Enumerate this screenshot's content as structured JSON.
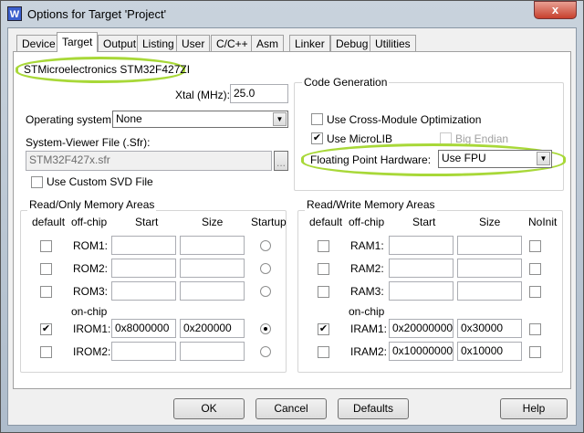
{
  "window": {
    "title": "Options for Target 'Project'",
    "icon": "W",
    "close": "x"
  },
  "tabs": [
    "Device",
    "Target",
    "Output",
    "Listing",
    "User",
    "C/C++",
    "Asm",
    "Linker",
    "Debug",
    "Utilities"
  ],
  "active_tab": "Target",
  "device": "STMicroelectronics STM32F427ZI",
  "xtal": {
    "label": "Xtal (MHz):",
    "value": "25.0"
  },
  "os": {
    "label": "Operating system:",
    "value": "None"
  },
  "svf": {
    "label": "System-Viewer File (.Sfr):",
    "value": "STM32F427x.sfr",
    "browse": "..."
  },
  "custom_svd": {
    "label": "Use Custom SVD File",
    "checked": false
  },
  "codegen": {
    "title": "Code Generation",
    "cross_module": "Use Cross-Module Optimization",
    "microlib": "Use MicroLIB",
    "big_endian": "Big Endian",
    "fph_label": "Floating Point Hardware:",
    "fph_value": "Use FPU"
  },
  "ro": {
    "title": "Read/Only Memory Areas",
    "headers": [
      "default",
      "off-chip",
      "Start",
      "Size",
      "Startup"
    ],
    "onchip": "on-chip",
    "rows": [
      {
        "name": "ROM1:",
        "default": false,
        "start": "",
        "size": "",
        "sel": false
      },
      {
        "name": "ROM2:",
        "default": false,
        "start": "",
        "size": "",
        "sel": false
      },
      {
        "name": "ROM3:",
        "default": false,
        "start": "",
        "size": "",
        "sel": false
      },
      {
        "name": "IROM1:",
        "default": true,
        "start": "0x8000000",
        "size": "0x200000",
        "sel": true
      },
      {
        "name": "IROM2:",
        "default": false,
        "start": "",
        "size": "",
        "sel": false
      }
    ]
  },
  "rw": {
    "title": "Read/Write Memory Areas",
    "headers": [
      "default",
      "off-chip",
      "Start",
      "Size",
      "NoInit"
    ],
    "onchip": "on-chip",
    "rows": [
      {
        "name": "RAM1:",
        "default": false,
        "start": "",
        "size": "",
        "sel": false
      },
      {
        "name": "RAM2:",
        "default": false,
        "start": "",
        "size": "",
        "sel": false
      },
      {
        "name": "RAM3:",
        "default": false,
        "start": "",
        "size": "",
        "sel": false
      },
      {
        "name": "IRAM1:",
        "default": true,
        "start": "0x20000000",
        "size": "0x30000",
        "sel": false
      },
      {
        "name": "IRAM2:",
        "default": false,
        "start": "0x10000000",
        "size": "0x10000",
        "sel": false
      }
    ]
  },
  "buttons": {
    "ok": "OK",
    "cancel": "Cancel",
    "defaults": "Defaults",
    "help": "Help"
  }
}
